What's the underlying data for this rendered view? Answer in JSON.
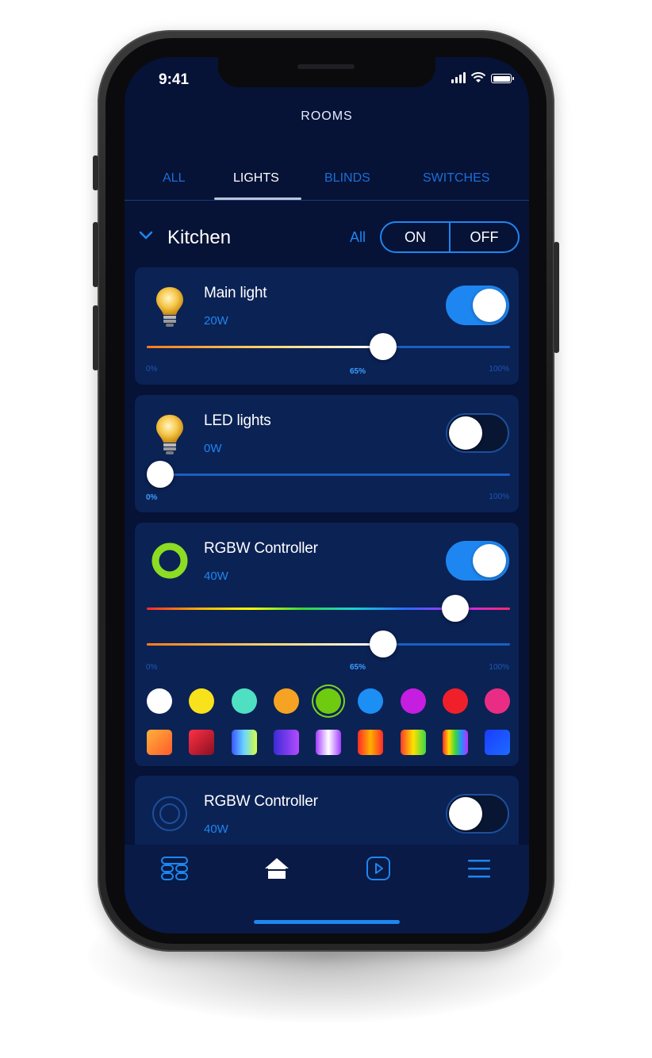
{
  "status_bar": {
    "time": "9:41"
  },
  "header": {
    "title": "ROOMS"
  },
  "tabs": [
    {
      "label": "ALL",
      "active": false
    },
    {
      "label": "LIGHTS",
      "active": true
    },
    {
      "label": "BLINDS",
      "active": false
    },
    {
      "label": "SWITCHES",
      "active": false
    }
  ],
  "room": {
    "name": "Kitchen",
    "all_label": "All",
    "on_label": "ON",
    "off_label": "OFF"
  },
  "devices": [
    {
      "name": "Main light",
      "power": "20W",
      "on": true,
      "icon": "light-bulb-icon",
      "brightness": 65,
      "min_label": "0%",
      "value_label": "65%",
      "max_label": "100%"
    },
    {
      "name": "LED lights",
      "power": "0W",
      "on": false,
      "icon": "light-bulb-icon",
      "brightness": 0,
      "min_label": "0%",
      "max_label": "100%"
    },
    {
      "name": "RGBW Controller",
      "power": "40W",
      "on": true,
      "icon": "ring-icon",
      "hue": 85,
      "brightness": 65,
      "min_label": "0%",
      "value_label": "65%",
      "max_label": "100%",
      "colors": [
        "#ffffff",
        "#f7e21c",
        "#4fe0c4",
        "#f6a323",
        "#6fcb10",
        "#1c8ff5",
        "#c51ee0",
        "#f0202a",
        "#ea2d84"
      ],
      "selected_color": 4,
      "gradients": [
        "linear-gradient(135deg,#ffb13b,#ff5b2a)",
        "linear-gradient(135deg,#ff3045,#8a1020)",
        "linear-gradient(90deg,#3a55ff,#6bd6ff,#d6ff40)",
        "linear-gradient(90deg,#3b2bd6,#b34bff)",
        "linear-gradient(90deg,#a43cff,#ffffff,#a43cff)",
        "linear-gradient(90deg,#ff2a2a,#ffb000,#ff2a2a)",
        "linear-gradient(90deg,#ff3a2a,#ffe200,#36d84a)",
        "linear-gradient(90deg,#ff2a2a,#ffdd00,#3bd83b,#2a8cff,#c02bff)",
        "linear-gradient(135deg,#1a3cff,#1d6bff)"
      ]
    },
    {
      "name": "RGBW Controller",
      "power": "40W",
      "on": false,
      "icon": "ring-icon"
    }
  ],
  "nav": [
    {
      "icon": "scenes-icon",
      "active": false
    },
    {
      "icon": "home-icon",
      "active": true
    },
    {
      "icon": "media-play-icon",
      "active": false
    },
    {
      "icon": "menu-icon",
      "active": false
    }
  ]
}
